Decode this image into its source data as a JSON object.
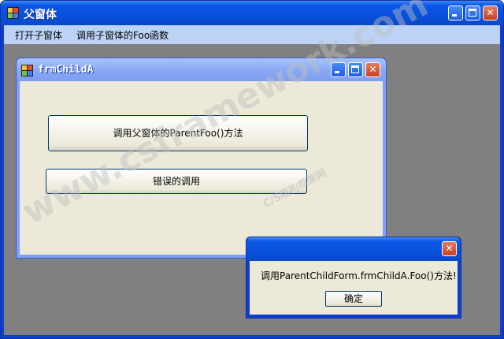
{
  "parent_window": {
    "title": "父窗体",
    "menu": [
      "打开子窗体",
      "调用子窗体的Foo函数"
    ]
  },
  "child_window": {
    "title": "frmChildA",
    "buttons": {
      "call_parent_label": "调用父窗体的ParentFoo()方法",
      "wrong_call_label": "错误的调用"
    }
  },
  "message_box": {
    "text": "调用ParentChildForm.frmChildA.Foo()方法!",
    "ok_label": "确定"
  },
  "watermark": {
    "site": "www.csframework.com",
    "tagline": "C/S结构框架网"
  },
  "colors": {
    "titlebar_blue": "#0850dd",
    "inactive_titlebar": "#8aa9f4",
    "mdi_background": "#808080",
    "dialog_face": "#ece9d8",
    "menubar": "#bcd3f6"
  }
}
